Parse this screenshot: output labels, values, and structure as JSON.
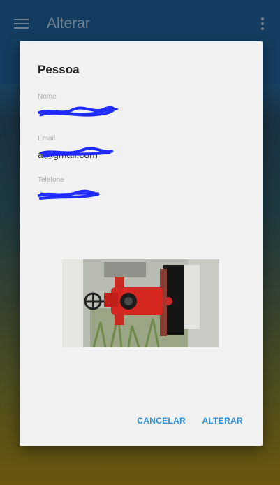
{
  "app": {
    "title": "Alterar",
    "menu_icon": "hamburger-menu-icon",
    "more_icon": "more-vert-icon"
  },
  "dialog": {
    "title": "Pessoa",
    "fields": [
      {
        "label": "Nome",
        "value": ""
      },
      {
        "label": "Email",
        "value": "a@gmail.com"
      },
      {
        "label": "Telefone",
        "value": ""
      }
    ],
    "cancel_label": "CANCELAR",
    "confirm_label": "ALTERAR"
  },
  "colors": {
    "accent": "#2b8fd9",
    "appbar": "#16466e",
    "dialog_bg": "#f1f1f1",
    "redaction": "#1f2bff"
  }
}
